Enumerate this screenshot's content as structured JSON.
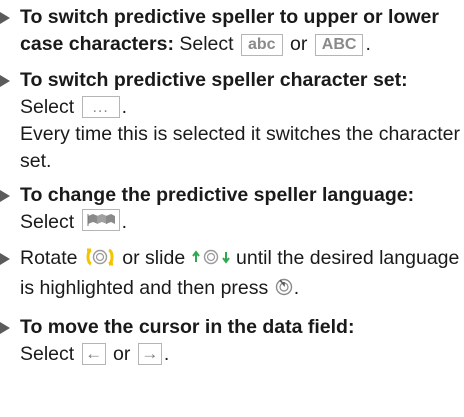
{
  "items": [
    {
      "bold": "To switch predictive speller to upper or lower case characters:",
      "pre": "Select",
      "key1": "abc",
      "mid": "or",
      "key2": "ABC",
      "end": "."
    },
    {
      "bold": "To switch predictive speller character set:",
      "pre": "Select",
      "key": "...",
      "end": ".",
      "para": "Every time this is selected it switches the character set."
    },
    {
      "bold": "To change the predictive speller language:",
      "pre": "Select",
      "end": "."
    },
    {
      "pre": "Rotate",
      "mid": "or slide",
      "post": "until the desired language is highlighted and then press",
      "end": "."
    },
    {
      "bold": "To move the cursor in the data field:",
      "pre": "Select",
      "key1": "←",
      "mid": "or",
      "key2": "→",
      "end": "."
    }
  ],
  "colors": {
    "accent_yellow": "#f5c400",
    "accent_green": "#2fa84f",
    "key_border": "#b5b5b5",
    "bullet": "#5b5b5b"
  },
  "icons": [
    "bullet-triangle-icon",
    "flag-language-icon",
    "rotate-controller-icon",
    "slide-controller-icon",
    "press-controller-icon"
  ]
}
